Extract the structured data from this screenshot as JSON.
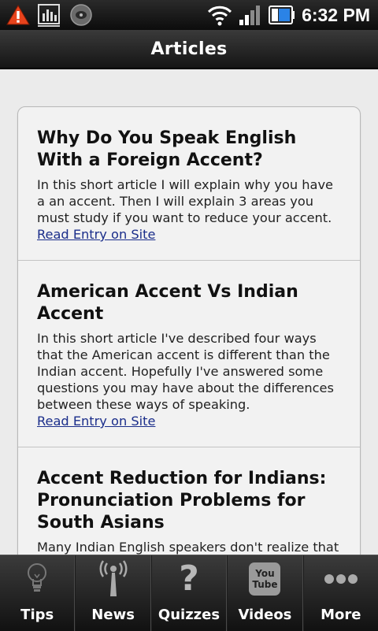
{
  "status_bar": {
    "time": "6:32 PM",
    "icons": [
      "warning-icon",
      "chart-icon",
      "media-icon",
      "wifi-icon",
      "signal-icon",
      "battery-icon"
    ]
  },
  "header": {
    "title": "Articles"
  },
  "articles": [
    {
      "title": "Why Do You Speak English With a Foreign Accent?",
      "description": "In this short article I will explain why you have a an accent. Then I will explain 3 areas you must study if you want to reduce your accent.",
      "link_label": "Read Entry on Site"
    },
    {
      "title": "American Accent Vs Indian Accent",
      "description": "In this short article I've described four ways that the American accent is different than the Indian accent. Hopefully I've answered some questions you may have about the differences between these ways of speaking.",
      "link_label": "Read Entry on Site"
    },
    {
      "title": "Accent Reduction for Indians: Pronunciation Problems for South Asians",
      "description": "Many Indian English speakers don't realize that",
      "link_label": ""
    }
  ],
  "tabs": [
    {
      "label": "Tips",
      "icon": "lightbulb-icon"
    },
    {
      "label": "News",
      "icon": "antenna-icon"
    },
    {
      "label": "Quizzes",
      "icon": "question-mark-icon"
    },
    {
      "label": "Videos",
      "icon": "youtube-icon",
      "icon_text_1": "You",
      "icon_text_2": "Tube"
    },
    {
      "label": "More",
      "icon": "more-dots-icon"
    }
  ],
  "colors": {
    "link": "#1a2d8a",
    "bar_dark": "#111111",
    "content_bg": "#ebebeb"
  }
}
